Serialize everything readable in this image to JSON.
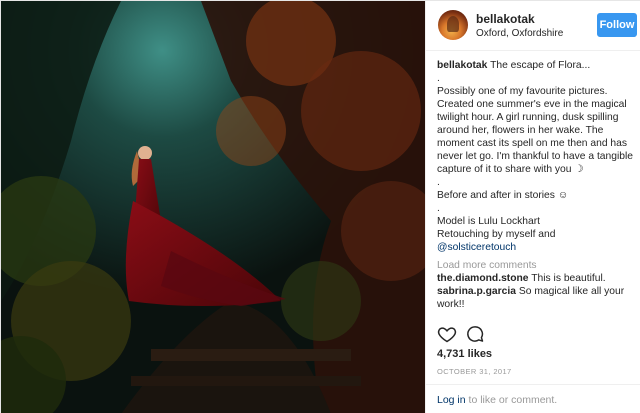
{
  "post": {
    "username": "bellakotak",
    "location": "Oxford, Oxfordshire",
    "follow_label": "Follow"
  },
  "caption": {
    "username": "bellakotak",
    "title": "The escape of Flora...",
    "dot1": ".",
    "text": "Possibly one of my favourite pictures. Created one summer's eve in the magical twilight hour. A girl running, dusk spilling around her, flowers in her wake. The moment cast its spell on me then and has never let go. I'm thankful to have a tangible capture of it to share with you ☽",
    "dot2": ".",
    "before_after": "Before and after in stories ☺",
    "dot3": ".",
    "model": "Model is Lulu Lockhart",
    "retouch": "Retouching by myself and",
    "mention": "@solsticeretouch"
  },
  "load_more": "Load more comments",
  "comments": [
    {
      "user": "the.diamond.stone",
      "text": "This is beautiful."
    },
    {
      "user": "sabrina.p.garcia",
      "text": "So magical like all your work!!"
    }
  ],
  "icons": {
    "like": "heart-icon",
    "comment": "comment-icon"
  },
  "likes": "4,731 likes",
  "date": "OCTOBER 31, 2017",
  "footer": {
    "login": "Log in",
    "rest": " to like or comment."
  },
  "colors": {
    "follow_bg": "#3897f0",
    "link": "#003569",
    "muted": "#999999"
  }
}
